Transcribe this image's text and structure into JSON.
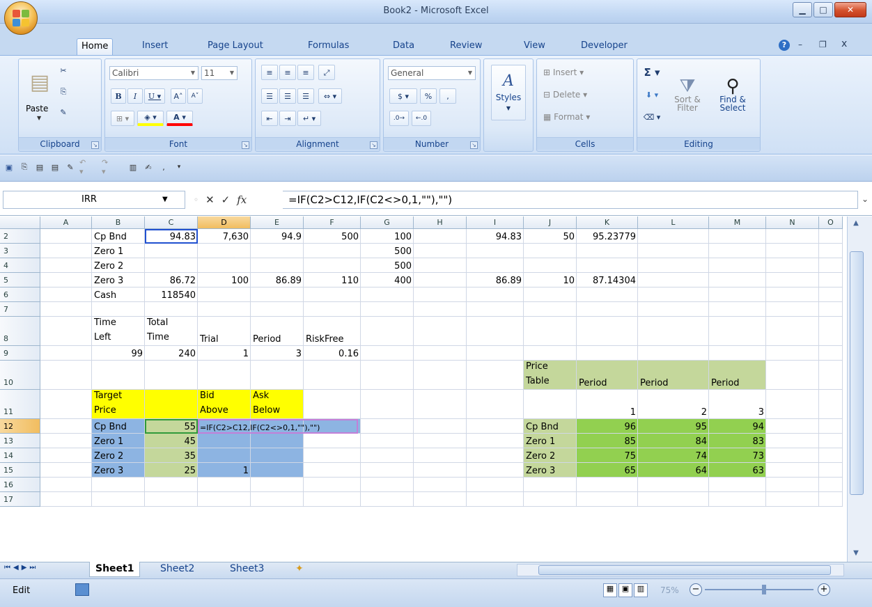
{
  "window": {
    "title": "Book2 - Microsoft Excel"
  },
  "tabs": [
    "Home",
    "Insert",
    "Page Layout",
    "Formulas",
    "Data",
    "Review",
    "View",
    "Developer"
  ],
  "ribbon": {
    "clipboard": {
      "label": "Clipboard",
      "paste": "Paste"
    },
    "font": {
      "label": "Font",
      "name": "Calibri",
      "size": "11"
    },
    "alignment": {
      "label": "Alignment"
    },
    "number": {
      "label": "Number",
      "format": "General"
    },
    "styles": {
      "label": "Styles"
    },
    "cells": {
      "label": "Cells",
      "insert": "Insert",
      "delete": "Delete",
      "format": "Format"
    },
    "editing": {
      "label": "Editing",
      "sort": "Sort &",
      "filter": "Filter",
      "find": "Find &",
      "select": "Select"
    }
  },
  "formula_bar": {
    "name_box": "IRR",
    "formula": "=IF(C2>C12,IF(C2<>0,1,\"\"),\"\")"
  },
  "columns": [
    "A",
    "B",
    "C",
    "D",
    "E",
    "F",
    "G",
    "H",
    "I",
    "J",
    "K",
    "L",
    "M",
    "N",
    "O"
  ],
  "rows": [
    "2",
    "3",
    "4",
    "5",
    "6",
    "7",
    "8",
    "9",
    "10",
    "11",
    "12",
    "13",
    "14",
    "15",
    "16",
    "17"
  ],
  "cells": {
    "B2": "Cp Bnd",
    "C2": "94.83",
    "D2": "7,630",
    "E2": "94.9",
    "F2": "500",
    "G2": "100",
    "I2": "94.83",
    "J2": "50",
    "K2": "95.23779",
    "B3": "Zero 1",
    "G3": "500",
    "B4": "Zero 2",
    "G4": "500",
    "B5": "Zero 3",
    "C5": "86.72",
    "D5": "100",
    "E5": "86.89",
    "F5": "110",
    "G5": "400",
    "I5": "86.89",
    "J5": "10",
    "K5": "87.14304",
    "B6": "Cash",
    "C6": "118540",
    "B8": "Time\nLeft",
    "C8": "Total\nTime",
    "D8": "Trial",
    "E8": "Period",
    "F8": "RiskFree",
    "B9": "99",
    "C9": "240",
    "D9": "1",
    "E9": "3",
    "F9": "0.16",
    "J10": "Price\nTable",
    "K10": "Period",
    "L10": "Period",
    "M10": "Period",
    "B11": "Target\nPrice",
    "D11": "Bid\nAbove",
    "E11": "Ask\nBelow",
    "K11": "1",
    "L11": "2",
    "M11": "3",
    "B12": "Cp Bnd",
    "C12": "55",
    "D12": "=IF(C2>C12,IF(C2<>0,1,\"\"),\"\")",
    "J12": "Cp Bnd",
    "K12": "96",
    "L12": "95",
    "M12": "94",
    "B13": "Zero 1",
    "C13": "45",
    "J13": "Zero 1",
    "K13": "85",
    "L13": "84",
    "M13": "83",
    "B14": "Zero 2",
    "C14": "35",
    "J14": "Zero 2",
    "K14": "75",
    "L14": "74",
    "M14": "73",
    "B15": "Zero 3",
    "C15": "25",
    "D15": "1",
    "J15": "Zero 3",
    "K15": "65",
    "L15": "64",
    "M15": "63"
  },
  "sheets": [
    "Sheet1",
    "Sheet2",
    "Sheet3"
  ],
  "status": {
    "mode": "Edit",
    "zoom": "75%"
  },
  "colors": {
    "yellow": "#ffff00",
    "olive": "#c4d79b",
    "blue_fill": "#8db4e2",
    "green": "#92d050",
    "light_green": "#c4d79b"
  }
}
